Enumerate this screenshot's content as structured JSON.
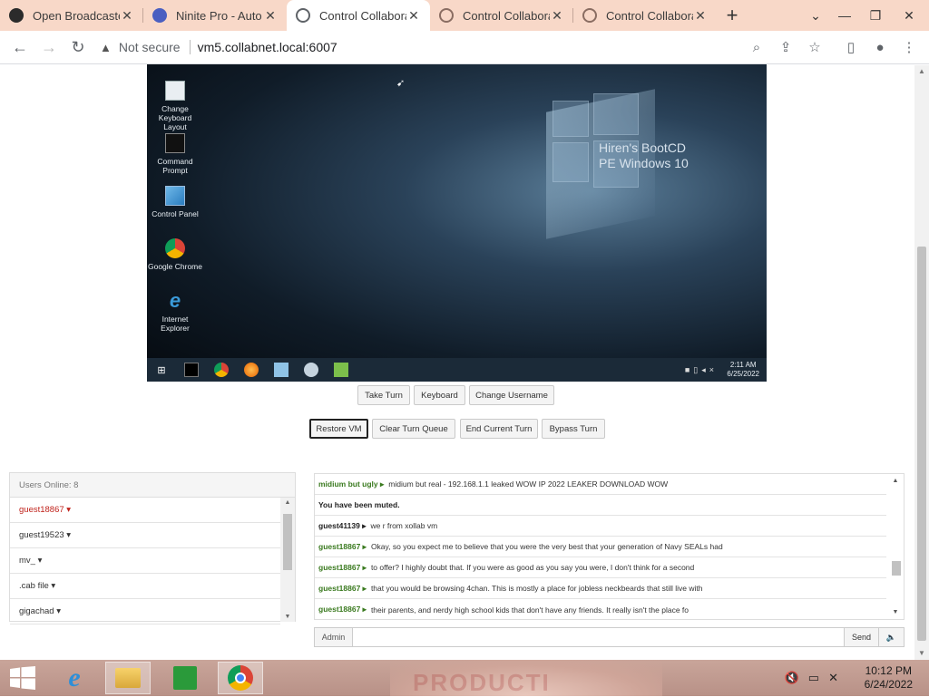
{
  "browser": {
    "tabs": [
      {
        "title": "Open Broadcaster",
        "favicon_color": "#333333",
        "active": false
      },
      {
        "title": "Ninite Pro - Auto",
        "favicon_color": "#4a5fc1",
        "active": false
      },
      {
        "title": "Control Collabora",
        "favicon_color": "#5f6368",
        "active": true
      },
      {
        "title": "Control Collabora",
        "favicon_color": "#8a6d62",
        "active": false
      },
      {
        "title": "Control Collabora",
        "favicon_color": "#8a6d62",
        "active": false
      }
    ],
    "security_label": "Not secure",
    "url": "vm5.collabnet.local:6007"
  },
  "vm": {
    "desktop_icons": [
      {
        "label": "Change Keyboard Layout",
        "icon": "keyboard-icon"
      },
      {
        "label": "Command Prompt",
        "icon": "terminal-icon"
      },
      {
        "label": "Control Panel",
        "icon": "control-panel-icon"
      },
      {
        "label": "Google Chrome",
        "icon": "chrome-icon"
      },
      {
        "label": "Internet Explorer",
        "icon": "ie-icon"
      }
    ],
    "brand_line1": "Hiren's BootCD",
    "brand_line2": "PE Windows 10",
    "clock_time": "2:11 AM",
    "clock_date": "6/25/2022"
  },
  "controls": {
    "take_turn": "Take Turn",
    "keyboard": "Keyboard",
    "change_username": "Change Username",
    "restore_vm": "Restore VM",
    "clear_turn_queue": "Clear Turn Queue",
    "end_current_turn": "End Current Turn",
    "bypass_turn": "Bypass Turn"
  },
  "users": {
    "header": "Users Online: 8",
    "list": [
      {
        "name": "guest18867 ▾",
        "self": true
      },
      {
        "name": "guest19523 ▾",
        "self": false
      },
      {
        "name": "mv_ ▾",
        "self": false
      },
      {
        "name": ".cab file ▾",
        "self": false
      },
      {
        "name": "gigachad ▾",
        "self": false
      }
    ]
  },
  "chat": {
    "messages": [
      {
        "user": "midium but ugly ▸",
        "text": "midium but real - 192.168.1.1 leaked WOW IP 2022 LEAKER DOWNLOAD WOW",
        "color": "green"
      },
      {
        "user": "",
        "text": "You have been muted.",
        "color": "system"
      },
      {
        "user": "guest41139 ▸",
        "text": "we r from xollab vm",
        "color": "black"
      },
      {
        "user": "guest18867 ▸",
        "text": "Okay, so you expect me to believe that you were the very best that your generation of Navy SEALs had",
        "color": "green"
      },
      {
        "user": "guest18867 ▸",
        "text": "to offer? I highly doubt that. If you were as good as you say you were, I don't think for a second",
        "color": "green"
      },
      {
        "user": "guest18867 ▸",
        "text": "that you would be browsing 4chan. This is mostly a place for jobless neckbeards that still live with",
        "color": "green"
      },
      {
        "user": "guest18867 ▸",
        "text": "their parents, and nerdy high school kids that don't have any friends. It really isn't the place fo",
        "color": "green"
      }
    ],
    "admin_label": "Admin",
    "send_label": "Send",
    "input_value": ""
  },
  "host": {
    "time": "10:12 PM",
    "date": "6/24/2022",
    "wallpaper_text": "PRODUCTI"
  }
}
